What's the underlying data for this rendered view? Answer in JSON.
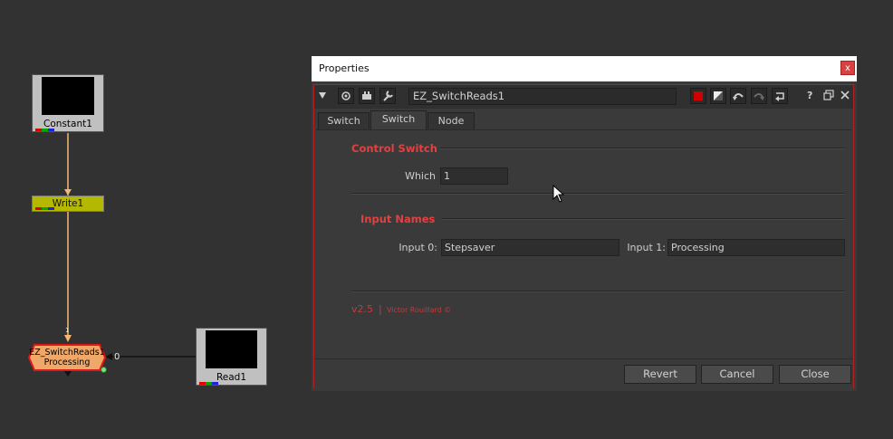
{
  "node_graph": {
    "nodes": [
      {
        "name": "Constant1"
      },
      {
        "name": "Write1"
      },
      {
        "name": "EZ_SwitchReads1",
        "subtitle": "Processing"
      },
      {
        "name": "Read1"
      }
    ],
    "switch_input_index": "0",
    "switch_input_top_index": "1"
  },
  "properties": {
    "window_title": "Properties",
    "close_glyph": "x",
    "node_name": "EZ_SwitchReads1",
    "tabs": [
      {
        "label": "Switch"
      },
      {
        "label": "Switch"
      },
      {
        "label": "Node"
      }
    ],
    "active_tab": "Switch",
    "control_switch": {
      "title": "Control Switch",
      "which_label": "Which",
      "which_value": "1"
    },
    "input_names": {
      "title": "Input Names",
      "input0_label": "Input 0:",
      "input0_value": "Stepsaver",
      "input1_label": "Input 1:",
      "input1_value": "Processing"
    },
    "version": "v2.5",
    "version_sep": "|",
    "credit": "Victor Rouillard ©",
    "buttons": {
      "revert": "Revert",
      "cancel": "Cancel",
      "close": "Close"
    },
    "toolbar_icons": [
      "collapse-arrow-icon",
      "center-node-icon",
      "input-node-icon",
      "wrench-icon",
      "color-swatch-icon",
      "gradient-swatch-icon",
      "undo-icon",
      "redo-icon",
      "revert-icon",
      "help-icon",
      "float-icon",
      "close-icon"
    ],
    "toolbar_help": "?"
  },
  "colors": {
    "accent_red": "#e04141",
    "write_node": "#b5b800",
    "switch_node": "#f0a868",
    "wire": "#f4b870",
    "swatch_red": "#d00000"
  }
}
